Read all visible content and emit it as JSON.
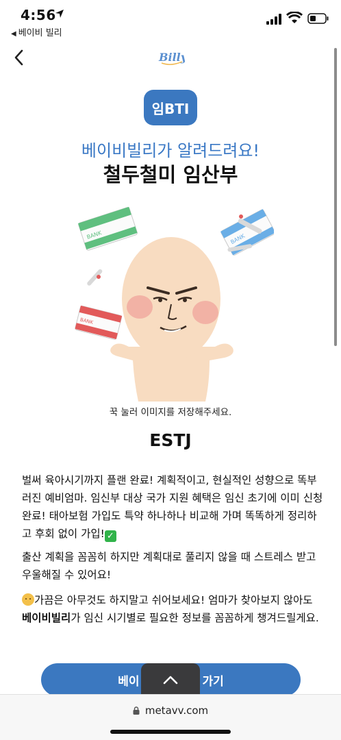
{
  "status_bar": {
    "time": "4:56",
    "back_app": "베이비 빌리"
  },
  "nav": {
    "logo_text": "Billy"
  },
  "badge": "임BTI",
  "subtitle": "베이비빌리가 알려드려요!",
  "title": "철두철미 임산부",
  "illustration": {
    "bank_label": "BANK"
  },
  "caption": "꾹 눌러 이미지를 저장해주세요.",
  "mbti": "ESTJ",
  "description": {
    "p1": "벌써 육아시기까지 플랜 완료! 계획적이고, 현실적인 성향으로 똑부러진 예비엄마. 임신부 대상 국가 지원 혜택은 임신 초기에 이미 신청 완료! 태아보험 가입도 특약 하나하나 비교해 가며 똑똑하게 정리하고 후회 없이 가입!",
    "p2": "출산 계획을 꼼꼼히 하지만 계획대로 풀리지 않을 때 스트레스 받고 우울해질 수 있어요!",
    "p3_pre": "가끔은 아무것도 하지말고 쉬어보세요! 엄마가 찾아보지 않아도 ",
    "p3_bold": "베이비빌리",
    "p3_post": "가 임신 시기별로 필요한 정보를 꼼꼼하게 챙겨드릴게요."
  },
  "cta": {
    "left": "베이",
    "right": "가기"
  },
  "url_bar": {
    "url": "metavv.com"
  },
  "colors": {
    "accent": "#3b78c0",
    "subtitle": "#3a78c5"
  }
}
